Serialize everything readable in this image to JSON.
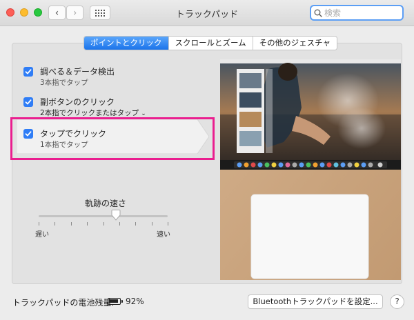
{
  "window": {
    "title": "トラックパッド",
    "search": {
      "placeholder": "検索",
      "value": ""
    }
  },
  "tabs": [
    {
      "label": "ポイントとクリック",
      "active": true
    },
    {
      "label": "スクロールとズーム",
      "active": false
    },
    {
      "label": "その他のジェスチャ",
      "active": false
    }
  ],
  "options": [
    {
      "title": "調べる＆データ検出",
      "subtitle": "3本指でタップ",
      "checked": true
    },
    {
      "title": "副ボタンのクリック",
      "subtitle": "2本指でクリックまたはタップ",
      "checked": true,
      "has_dropdown": true
    },
    {
      "title": "タップでクリック",
      "subtitle": "1本指でタップ",
      "checked": true,
      "selected": true
    }
  ],
  "tracking_speed": {
    "label": "軌跡の速さ",
    "min_label": "遅い",
    "max_label": "速い",
    "value_fraction": 0.6
  },
  "footer": {
    "battery_label": "トラックパッドの電池残量:",
    "battery_level": "92%",
    "bluetooth_button": "Bluetoothトラックパッドを設定...",
    "help_button": "?"
  },
  "colors": {
    "accent": "#2f7df6",
    "highlight_box": "#ea1e8f",
    "desk": "#c9a47f"
  }
}
